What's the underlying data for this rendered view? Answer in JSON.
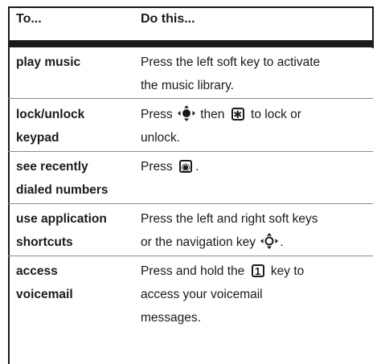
{
  "header": {
    "col1": "To...",
    "col2": "Do this..."
  },
  "rows": [
    {
      "action": [
        "play music"
      ],
      "instruction": [
        "Press the left soft key to activate",
        "the music library."
      ]
    },
    {
      "action": [
        "lock/unlock",
        "keypad"
      ],
      "instruction_parts": {
        "a": "Press",
        "b": "then",
        "c": "to lock or",
        "d": "unlock."
      },
      "key_star": "✱"
    },
    {
      "action": [
        "see recently",
        "dialed numbers"
      ],
      "instruction_parts": {
        "a": "Press",
        "b": "."
      },
      "key_send": "◉"
    },
    {
      "action": [
        "use application",
        "shortcuts"
      ],
      "instruction": [
        "Press the left and right soft keys",
        "or the navigation key"
      ],
      "instruction_tail": "."
    },
    {
      "action": [
        "access",
        "voicemail"
      ],
      "instruction_parts": {
        "a": "Press and hold the",
        "b": "key to",
        "c": "access your voicemail",
        "d": "messages."
      },
      "key_one": "1"
    }
  ]
}
